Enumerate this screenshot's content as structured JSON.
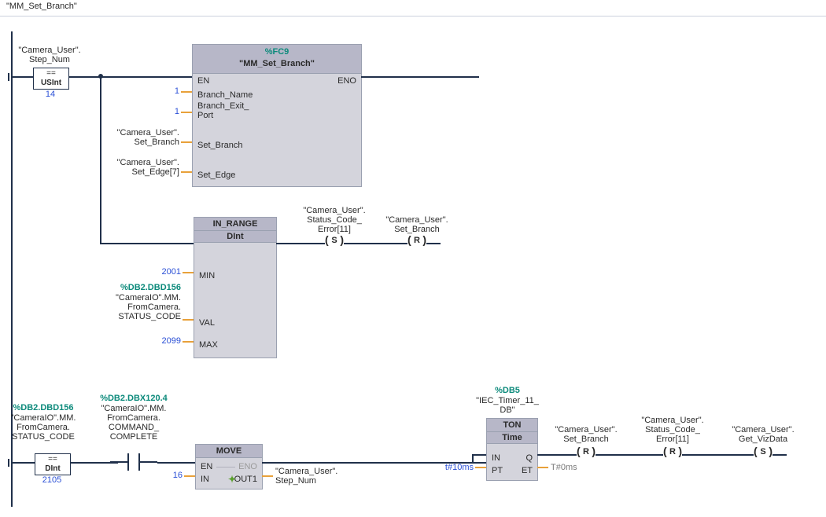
{
  "network": {
    "title": "\"MM_Set_Branch\""
  },
  "contact1": {
    "tag_line1": "\"Camera_User\".",
    "tag_line2": "Step_Num",
    "cmp_op": "==",
    "cmp_type": "USInt",
    "value": "14"
  },
  "fc9": {
    "addr": "%FC9",
    "name": "\"MM_Set_Branch\"",
    "ports": {
      "en": "EN",
      "eno": "ENO",
      "branch_name": "Branch_Name",
      "branch_exit_port_line1": "Branch_Exit_",
      "branch_exit_port_line2": "Port",
      "set_branch": "Set_Branch",
      "set_edge": "Set_Edge"
    },
    "args": {
      "branch_name": "1",
      "branch_exit_port": "1",
      "set_branch_line1": "\"Camera_User\".",
      "set_branch_line2": "Set_Branch",
      "set_edge_line1": "\"Camera_User\".",
      "set_edge_line2": "Set_Edge[7]"
    }
  },
  "in_range": {
    "name": "IN_RANGE",
    "type": "DInt",
    "ports": {
      "min": "MIN",
      "val": "VAL",
      "max": "MAX"
    },
    "args": {
      "min": "2001",
      "max": "2099",
      "val_addr": "%DB2.DBD156",
      "val_line1": "\"CameraIO\".MM.",
      "val_line2": "FromCamera.",
      "val_line3": "STATUS_CODE"
    },
    "out": {
      "coil1_line1": "\"Camera_User\".",
      "coil1_line2": "Status_Code_",
      "coil1_line3": "Error[11]",
      "coil1_type": "S",
      "coil2_line1": "\"Camera_User\".",
      "coil2_line2": "Set_Branch",
      "coil2_type": "R"
    }
  },
  "rung2": {
    "cmp_addr": "%DB2.DBD156",
    "cmp_line1": "\"CameraIO\".MM.",
    "cmp_line2": "FromCamera.",
    "cmp_line3": "STATUS_CODE",
    "cmp_op": "==",
    "cmp_type": "DInt",
    "cmp_value": "2105",
    "nopen_addr": "%DB2.DBX120.4",
    "nopen_line1": "\"CameraIO\".MM.",
    "nopen_line2": "FromCamera.",
    "nopen_line3": "COMMAND_",
    "nopen_line4": "COMPLETE",
    "move": {
      "name": "MOVE",
      "ports": {
        "en": "EN",
        "eno": "ENO",
        "in": "IN",
        "out1": "OUT1"
      },
      "in_val": "16",
      "out_line1": "\"Camera_User\".",
      "out_line2": "Step_Num"
    },
    "ton": {
      "addr": "%DB5",
      "inst_line1": "\"IEC_Timer_11_",
      "inst_line2": "DB\"",
      "name": "TON",
      "type": "Time",
      "ports": {
        "in": "IN",
        "pt": "PT",
        "q": "Q",
        "et": "ET"
      },
      "pt_val": "t#10ms",
      "et_val": "T#0ms"
    },
    "coil_setbranch_line1": "\"Camera_User\".",
    "coil_setbranch_line2": "Set_Branch",
    "coil_setbranch_type": "R",
    "coil_err_line1": "\"Camera_User\".",
    "coil_err_line2": "Status_Code_",
    "coil_err_line3": "Error[11]",
    "coil_err_type": "R",
    "coil_getviz_line1": "\"Camera_User\".",
    "coil_getviz_line2": "Get_VizData",
    "coil_getviz_type": "S"
  }
}
